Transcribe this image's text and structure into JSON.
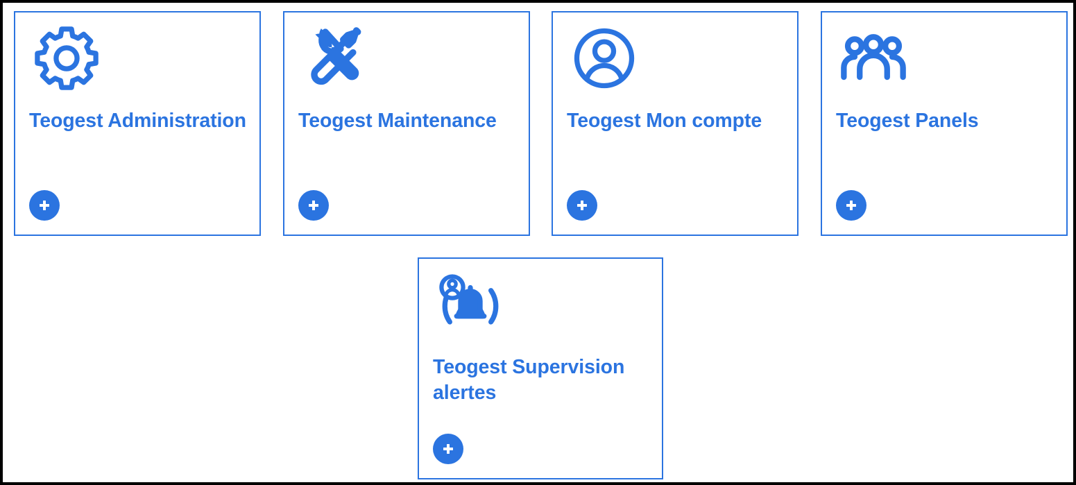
{
  "page": {
    "background_color": "#ffffff",
    "border_color": "#000000",
    "accent_color": "#2b74e0"
  },
  "tiles": [
    {
      "id": "teogest-administration",
      "title": "Teogest Administration",
      "icon": "gear-icon",
      "add_label": "+"
    },
    {
      "id": "teogest-maintenance",
      "title": "Teogest Maintenance",
      "icon": "tools-icon",
      "add_label": "+"
    },
    {
      "id": "teogest-mon-compte",
      "title": "Teogest Mon compte",
      "icon": "user-account-icon",
      "add_label": "+"
    },
    {
      "id": "teogest-panels",
      "title": "Teogest Panels",
      "icon": "people-group-icon",
      "add_label": "+"
    },
    {
      "id": "teogest-supervision-alertes",
      "title": "Teogest Supervision alertes",
      "icon": "alert-bell-person-icon",
      "add_label": "+"
    }
  ]
}
